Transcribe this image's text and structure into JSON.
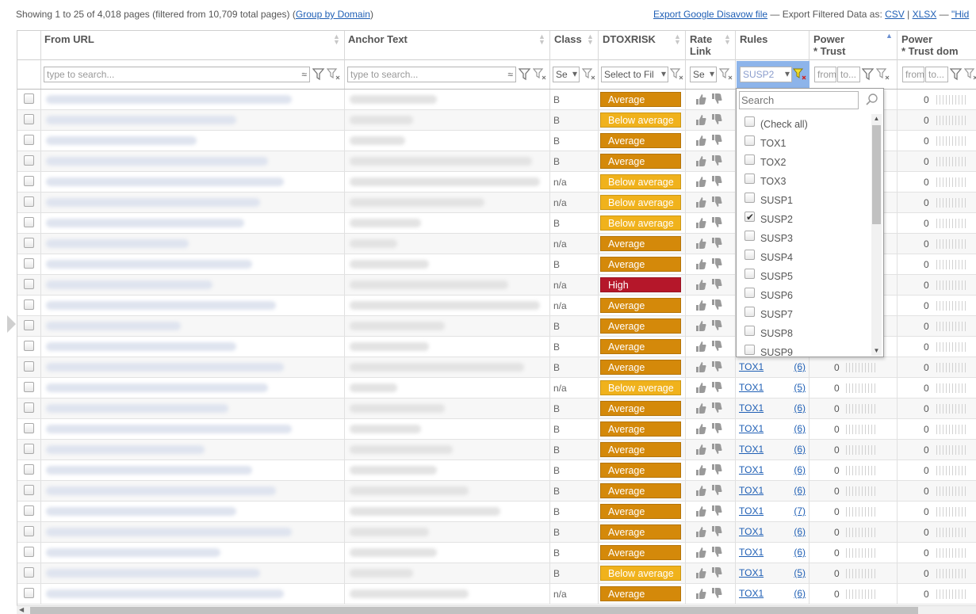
{
  "toolbar": {
    "status_prefix": "Showing 1 to 25 of 4,018 pages (filtered from 10,709 total pages) (",
    "group_link": "Group by Domain",
    "status_suffix": ")",
    "export_disavow": "Export Google Disavow file",
    "export_label": " — Export Filtered Data as: ",
    "export_csv": "CSV",
    "sep": " | ",
    "export_xlsx": "XLSX",
    "dash": " — ",
    "export_hidden": "\"Hid"
  },
  "columns": {
    "from_url": "From URL",
    "anchor": "Anchor Text",
    "class": "Class",
    "dtoxrisk": "DTOXRISK",
    "rate_link_1": "Rate",
    "rate_link_2": "Link",
    "rules": "Rules",
    "power_trust_1": "Power",
    "power_trust_2": "* Trust",
    "power_trust_dom_1": "Power",
    "power_trust_dom_2": "* Trust dom"
  },
  "filters": {
    "url_placeholder": "type to search...",
    "anchor_placeholder": "type to search...",
    "class_value": "Se",
    "dtox_value": "Select to Fil",
    "rate_value": "Se",
    "rules_value": "SUSP2",
    "from_placeholder": "from",
    "to_placeholder": "to...",
    "from2_placeholder": "from",
    "to2_placeholder": "to..."
  },
  "rows": [
    {
      "class": "B",
      "risk": "Average",
      "rule": "",
      "count": "",
      "power": "",
      "dom": "0"
    },
    {
      "class": "B",
      "risk": "Below average",
      "rule": "",
      "count": "",
      "power": "",
      "dom": "0"
    },
    {
      "class": "B",
      "risk": "Average",
      "rule": "",
      "count": "",
      "power": "",
      "dom": "0"
    },
    {
      "class": "B",
      "risk": "Average",
      "rule": "",
      "count": "",
      "power": "",
      "dom": "0"
    },
    {
      "class": "n/a",
      "risk": "Below average",
      "rule": "",
      "count": "",
      "power": "",
      "dom": "0"
    },
    {
      "class": "n/a",
      "risk": "Below average",
      "rule": "",
      "count": "",
      "power": "",
      "dom": "0"
    },
    {
      "class": "B",
      "risk": "Below average",
      "rule": "",
      "count": "",
      "power": "",
      "dom": "0"
    },
    {
      "class": "n/a",
      "risk": "Average",
      "rule": "",
      "count": "",
      "power": "",
      "dom": "0"
    },
    {
      "class": "B",
      "risk": "Average",
      "rule": "",
      "count": "",
      "power": "",
      "dom": "0"
    },
    {
      "class": "n/a",
      "risk": "High",
      "rule": "",
      "count": "",
      "power": "",
      "dom": "0"
    },
    {
      "class": "n/a",
      "risk": "Average",
      "rule": "",
      "count": "",
      "power": "",
      "dom": "0"
    },
    {
      "class": "B",
      "risk": "Average",
      "rule": "",
      "count": "",
      "power": "",
      "dom": "0"
    },
    {
      "class": "B",
      "risk": "Average",
      "rule": "",
      "count": "",
      "power": "",
      "dom": "0"
    },
    {
      "class": "B",
      "risk": "Average",
      "rule": "TOX1",
      "count": "(6)",
      "power": "0",
      "dom": "0"
    },
    {
      "class": "n/a",
      "risk": "Below average",
      "rule": "TOX1",
      "count": "(5)",
      "power": "0",
      "dom": "0"
    },
    {
      "class": "B",
      "risk": "Average",
      "rule": "TOX1",
      "count": "(6)",
      "power": "0",
      "dom": "0"
    },
    {
      "class": "B",
      "risk": "Average",
      "rule": "TOX1",
      "count": "(6)",
      "power": "0",
      "dom": "0"
    },
    {
      "class": "B",
      "risk": "Average",
      "rule": "TOX1",
      "count": "(6)",
      "power": "0",
      "dom": "0"
    },
    {
      "class": "B",
      "risk": "Average",
      "rule": "TOX1",
      "count": "(6)",
      "power": "0",
      "dom": "0"
    },
    {
      "class": "B",
      "risk": "Average",
      "rule": "TOX1",
      "count": "(6)",
      "power": "0",
      "dom": "0"
    },
    {
      "class": "B",
      "risk": "Average",
      "rule": "TOX1",
      "count": "(7)",
      "power": "0",
      "dom": "0"
    },
    {
      "class": "B",
      "risk": "Average",
      "rule": "TOX1",
      "count": "(6)",
      "power": "0",
      "dom": "0"
    },
    {
      "class": "B",
      "risk": "Average",
      "rule": "TOX1",
      "count": "(6)",
      "power": "0",
      "dom": "0"
    },
    {
      "class": "B",
      "risk": "Below average",
      "rule": "TOX1",
      "count": "(5)",
      "power": "0",
      "dom": "0"
    },
    {
      "class": "n/a",
      "risk": "Average",
      "rule": "TOX1",
      "count": "(6)",
      "power": "0",
      "dom": "0"
    }
  ],
  "risk_colors": {
    "Average": "#d4890a",
    "Below average": "#f0b21c",
    "High": "#b5172a"
  },
  "dropdown": {
    "search_placeholder": "Search",
    "items": [
      {
        "label": "(Check all)",
        "checked": false
      },
      {
        "label": "TOX1",
        "checked": false
      },
      {
        "label": "TOX2",
        "checked": false
      },
      {
        "label": "TOX3",
        "checked": false
      },
      {
        "label": "SUSP1",
        "checked": false
      },
      {
        "label": "SUSP2",
        "checked": true
      },
      {
        "label": "SUSP3",
        "checked": false
      },
      {
        "label": "SUSP4",
        "checked": false
      },
      {
        "label": "SUSP5",
        "checked": false
      },
      {
        "label": "SUSP6",
        "checked": false
      },
      {
        "label": "SUSP7",
        "checked": false
      },
      {
        "label": "SUSP8",
        "checked": false
      },
      {
        "label": "SUSP9",
        "checked": false
      }
    ]
  },
  "icons": {
    "filter": "funnel-icon",
    "clear_filter": "funnel-clear-icon",
    "thumbs": "thumbs-up-down-icon",
    "search": "magnifier-icon"
  }
}
